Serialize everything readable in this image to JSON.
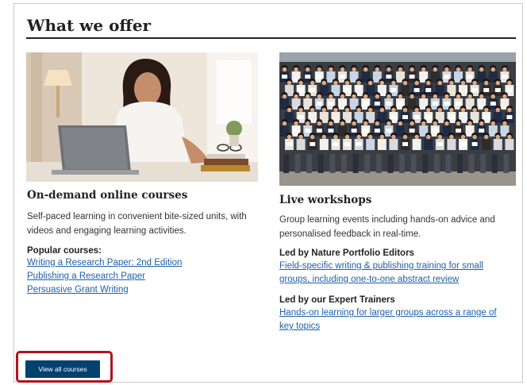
{
  "section": {
    "title": "What we offer"
  },
  "online": {
    "title": "On-demand online courses",
    "description_line1": "Self-paced learning in convenient bite-sized units, with",
    "description_line2": "videos and engaging learning activities.",
    "popular_label": "Popular courses:",
    "links": [
      "Writing a Research Paper: 2nd Edition",
      "Publishing a Research Paper",
      "Persuasive Grant Writing"
    ]
  },
  "workshops": {
    "title": "Live workshops",
    "description_line1": "Group learning events including hands-on advice and",
    "description_line2": "personalised feedback in real-time.",
    "editors_label": "Led by Nature Portfolio Editors",
    "editors_link_line1": "Field-specific writing & publishing training for small",
    "editors_link_line2": "groups, including one-to-one abstract review",
    "trainers_label": "Led by our Expert Trainers",
    "trainers_link_line1": "Hands-on learning for larger groups across a range of",
    "trainers_link_line2": "key topics"
  },
  "button": {
    "label": "View all courses"
  },
  "colors": {
    "button_bg": "#03416e",
    "highlight": "#b3121e",
    "link": "#1f5fa8"
  }
}
